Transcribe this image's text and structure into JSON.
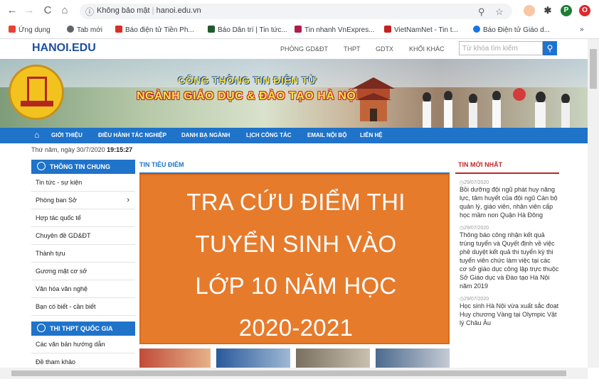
{
  "browser": {
    "omnibox_security": "Không bảo mật",
    "omnibox_url": "hanoi.edu.vn",
    "profile_initial": "P",
    "bookmarks": [
      {
        "label": "Ứng dụng",
        "color": "#e94235"
      },
      {
        "label": "Tab mới",
        "color": "#5f6368"
      },
      {
        "label": "Báo điện tử Tiền Ph...",
        "color": "#d93025"
      },
      {
        "label": "Báo Dân trí | Tin tức...",
        "color": "#1e5b2c"
      },
      {
        "label": "Tin nhanh VnExpres...",
        "color": "#b01d4a"
      },
      {
        "label": "VietNamNet - Tin t...",
        "color": "#c5221f"
      },
      {
        "label": "Báo Điện tử Giáo d...",
        "color": "#1a73e8"
      }
    ],
    "bookmarks_more": "»"
  },
  "site": {
    "logo": "HANOI.EDU",
    "top_nav": [
      "PHÒNG GD&ĐT",
      "THPT",
      "GDTX",
      "KHỐI KHÁC"
    ],
    "search_placeholder": "Từ khóa tìm kiếm",
    "banner_line1": "CỔNG THÔNG TIN ĐIỆN TỬ",
    "banner_line2": "NGÀNH GIÁO DỤC & ĐÀO TẠO HÀ NỘI",
    "main_nav": [
      "GIỚI THIỆU",
      "ĐIỀU HÀNH TÁC NGHIỆP",
      "DANH BẠ NGÀNH",
      "LỊCH CÔNG TÁC",
      "EMAIL NỘI BỘ",
      "LIÊN HỆ"
    ],
    "date_prefix": "Thứ năm, ngày 30/7/2020",
    "date_time": "19:15:27",
    "sidebar1_head": "THÔNG TIN CHUNG",
    "sidebar1_items": [
      "Tin tức - sự kiện",
      "Phòng ban Sở",
      "Hợp tác quốc tế",
      "Chuyên đề GD&ĐT",
      "Thành tựu",
      "Gương mặt cơ sở",
      "Văn hóa văn nghệ",
      "Bạn có biết - cần biết"
    ],
    "sidebar2_head": "THI THPT QUỐC GIA",
    "sidebar2_items": [
      "Các văn bản hướng dẫn",
      "Đề tham khảo"
    ],
    "center_head": "TIN TIÊU ĐIỂM",
    "overlay_lines": [
      "TRA CỨU ĐIỂM THI",
      "TUYỂN SINH VÀO",
      "LỚP 10 NĂM HỌC",
      "2020-2021"
    ],
    "right_head": "TIN MỚI NHẤT",
    "news": [
      {
        "date": "29/07/2020",
        "title": "Bồi dưỡng đội ngũ phát huy năng lực, tâm huyết của đội ngũ Cán bộ quản lý, giáo viên, nhân viên cấp học mầm non Quận Hà Đông"
      },
      {
        "date": "29/07/2020",
        "title": "Thông báo công nhận kết quả trúng tuyển và Quyết định về việc phê duyệt kết quả thi tuyển kỳ thi tuyển viên chức làm việc tại các cơ sở giáo dục công lập trực thuộc Sở Giáo dục và Đào tạo Hà Nội năm 2019"
      },
      {
        "date": "29/07/2020",
        "title": "Học sinh Hà Nội vừa xuất sắc đoạt Huy chương Vàng tại Olympic Vật lý Châu Âu"
      }
    ]
  },
  "colors": {
    "primary_blue": "#1f73c9",
    "overlay_orange": "#e67b2c",
    "news_red": "#c0262a"
  }
}
